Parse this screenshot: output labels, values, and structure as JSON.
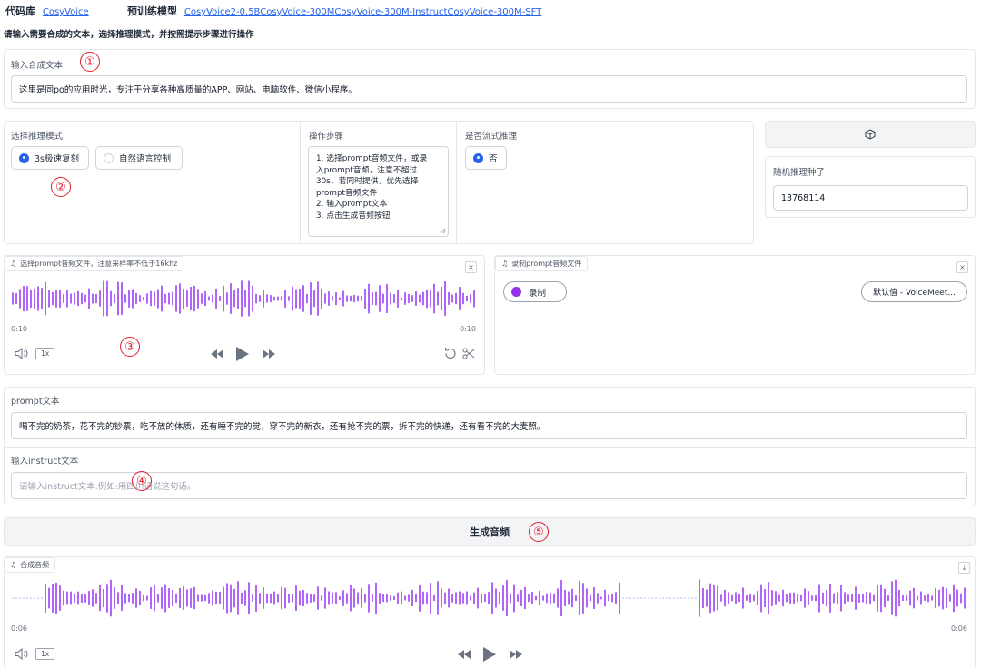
{
  "header": {
    "repo_label": "代码库",
    "repo_link": "CosyVoice",
    "model_label": "预训练模型",
    "model_links": [
      "CosyVoice2-0.5B",
      "CosyVoice-300M",
      "CosyVoice-300M-Instruct",
      "CosyVoice-300M-SFT"
    ],
    "instruction": "请输入需要合成的文本，选择推理模式，并按照提示步骤进行操作"
  },
  "markers": [
    "①",
    "②",
    "③",
    "④",
    "⑤"
  ],
  "tts_text": {
    "label": "输入合成文本",
    "value": "这里是同po的应用时光，专注于分享各种高质量的APP、网站、电脑软件、微信小程序。"
  },
  "mode": {
    "label": "选择推理模式",
    "options": [
      "3s极速复刻",
      "自然语言控制"
    ],
    "selected": 0
  },
  "steps": {
    "label": "操作步骤",
    "lines": [
      "1. 选择prompt音频文件，或录",
      "入prompt音频，注意不超过",
      "30s，若同时提供，优先选择",
      "prompt音频文件",
      "2. 输入prompt文本",
      "3. 点击生成音频按钮"
    ]
  },
  "stream": {
    "label": "是否流式推理",
    "option": "否"
  },
  "seed": {
    "dice_icon": "dice-icon",
    "label": "随机推理种子",
    "value": "13768114"
  },
  "prompt_audio": {
    "label": "选择prompt音频文件，注意采样率不低于16khz",
    "time_start": "0:10",
    "time_end": "0:10",
    "speed": "1x",
    "wave_color": "#a855f7"
  },
  "record": {
    "label": "录制prompt音频文件",
    "record_button": "录制",
    "device": "默认值 - VoiceMeet..."
  },
  "prompt_text": {
    "label": "prompt文本",
    "value": "喝不完的奶茶，花不完的钞票，吃不放的体质，还有睡不完的觉，穿不完的新衣，还有抢不完的票，拆不完的快递，还有看不完的大麦照。"
  },
  "instruct": {
    "label": "输入instruct文本",
    "placeholder": "请输入instruct文本.例如:用四川话说这句话。"
  },
  "generate": {
    "label": "生成音频"
  },
  "output": {
    "label": "合成音频",
    "time_start": "0:06",
    "time_end": "0:06",
    "speed": "1x"
  }
}
